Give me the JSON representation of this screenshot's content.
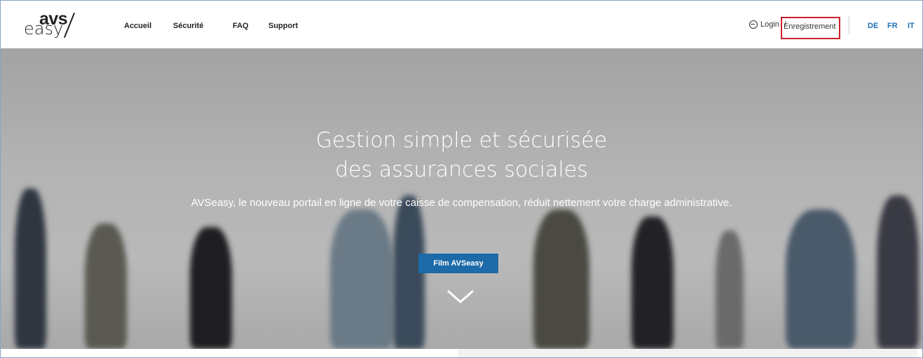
{
  "header": {
    "logo": {
      "top": "avs",
      "bottom": "easy"
    },
    "nav": [
      {
        "label": "Accueil"
      },
      {
        "label": "Sécurité"
      },
      {
        "label": "FAQ"
      },
      {
        "label": "Support"
      }
    ],
    "login_label": "Login",
    "separator": "/",
    "register_label": "Enregistrement",
    "languages": [
      "DE",
      "FR",
      "IT"
    ]
  },
  "hero": {
    "title_line1": "Gestion simple et sécurisée",
    "title_line2": "des assurances sociales",
    "subtitle": "AVSeasy, le nouveau portail en ligne de votre caisse de compensation, réduit nettement votre charge administrative.",
    "button_label": "Film AVSeasy"
  },
  "colors": {
    "accent": "#1c6aa8",
    "highlight_box": "#cc1f2a",
    "hero_bg": "#b3b3b3"
  },
  "icons": {
    "login": "login-icon",
    "scroll": "chevron-down-icon"
  }
}
